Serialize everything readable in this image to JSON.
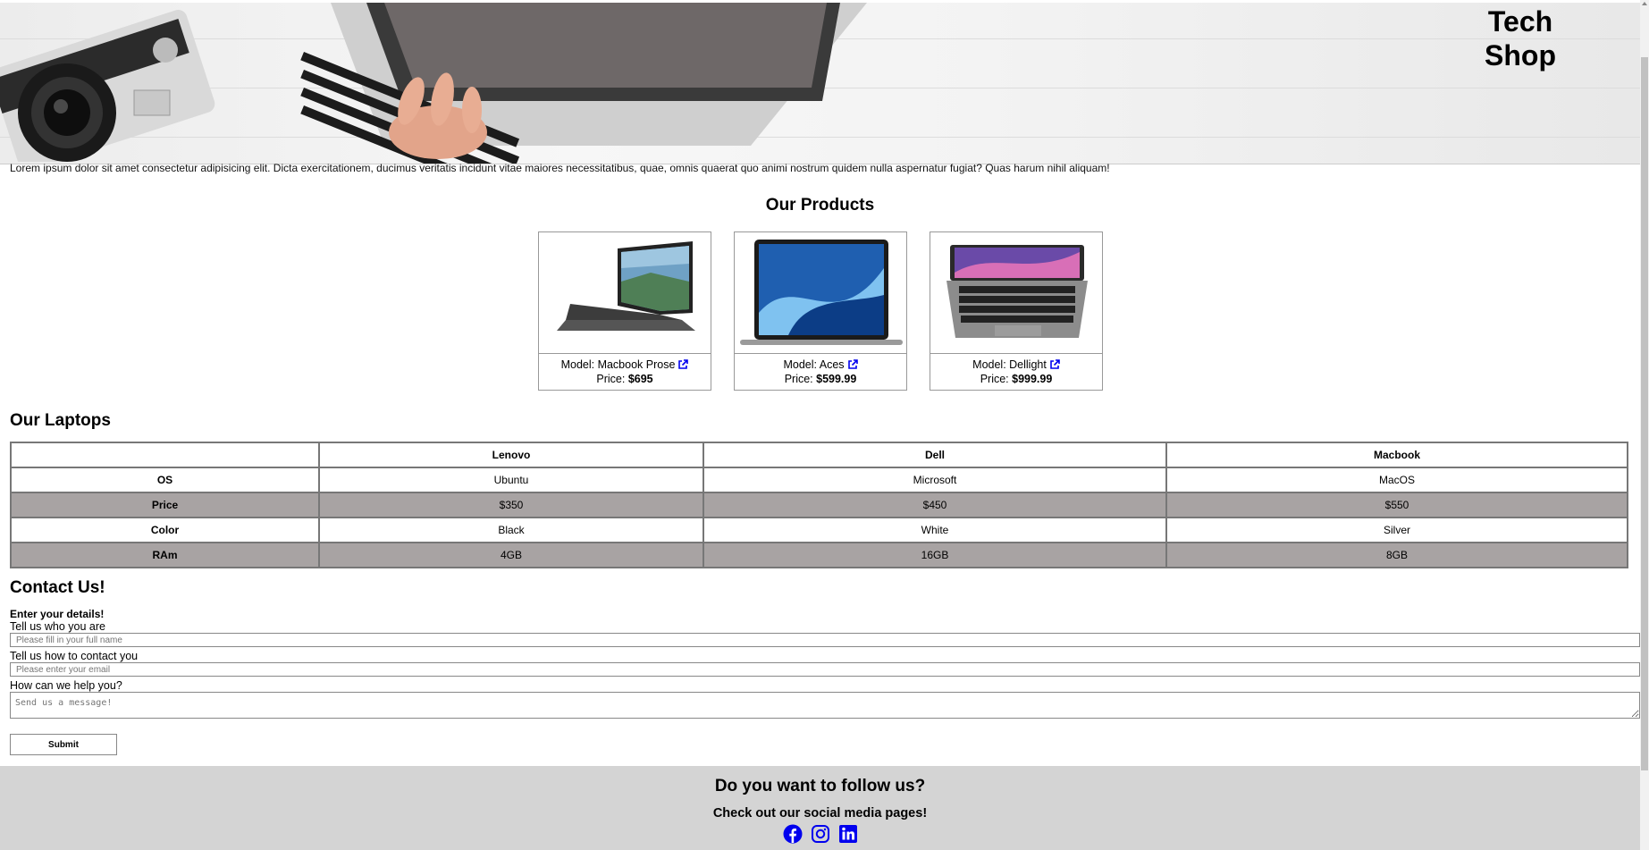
{
  "brand": {
    "line1": "Tech",
    "line2": "Shop"
  },
  "intro": "Lorem ipsum dolor sit amet consectetur adipisicing elit. Dicta exercitationem, ducimus veritatis incidunt vitae maiores necessitatibus, quae, omnis quaerat quo animi nostrum quidem nulla aspernatur fugiat? Quas harum nihil aliquam!",
  "products": {
    "title": "Our Products",
    "items": [
      {
        "model_label": "Model: Macbook Prose",
        "price_label": "Price:",
        "price": "$695"
      },
      {
        "model_label": "Model: Aces",
        "price_label": "Price:",
        "price": "$599.99"
      },
      {
        "model_label": "Model: Dellight",
        "price_label": "Price:",
        "price": "$999.99"
      }
    ]
  },
  "laptops": {
    "title": "Our Laptops",
    "columns": [
      "",
      "Lenovo",
      "Dell",
      "Macbook"
    ],
    "rows": [
      {
        "label": "OS",
        "values": [
          "Ubuntu",
          "Microsoft",
          "MacOS"
        ]
      },
      {
        "label": "Price",
        "values": [
          "$350",
          "$450",
          "$550"
        ]
      },
      {
        "label": "Color",
        "values": [
          "Black",
          "White",
          "Silver"
        ]
      },
      {
        "label": "RAm",
        "values": [
          "4GB",
          "16GB",
          "8GB"
        ]
      }
    ]
  },
  "contact": {
    "title": "Contact Us!",
    "subtitle": "Enter your details!",
    "name_label": "Tell us who you are",
    "name_placeholder": "Please fill in your full name",
    "email_label": "Tell us how to contact you",
    "email_placeholder": "Please enter your email",
    "message_label": "How can we help you?",
    "message_placeholder": "Send us a message!",
    "submit_label": "Submit"
  },
  "footer": {
    "title": "Do you want to follow us?",
    "subtitle": "Check out our social media pages!",
    "icons": [
      "facebook-icon",
      "instagram-icon",
      "linkedin-icon"
    ],
    "icon_color": "#0000ee"
  }
}
